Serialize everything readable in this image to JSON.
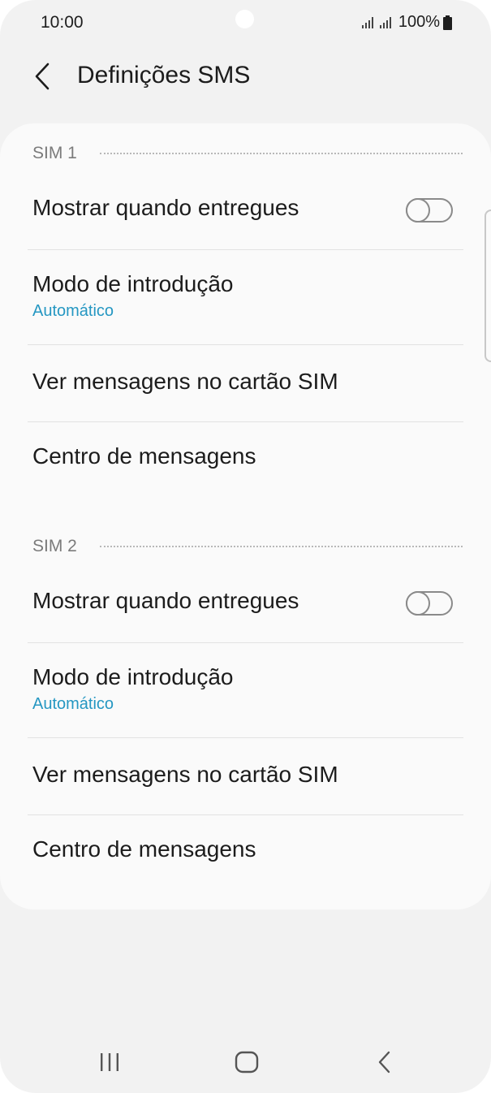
{
  "status_bar": {
    "time": "10:00",
    "battery": "100%"
  },
  "header": {
    "title": "Definições SMS",
    "back_icon": "chevron-left-icon"
  },
  "sections": [
    {
      "title": "SIM 1",
      "items": [
        {
          "label": "Mostrar quando entregues",
          "toggle": false
        },
        {
          "label": "Modo de introdução",
          "value": "Automático"
        },
        {
          "label": "Ver mensagens no cartão SIM"
        },
        {
          "label": "Centro de mensagens"
        }
      ]
    },
    {
      "title": "SIM 2",
      "items": [
        {
          "label": "Mostrar quando entregues",
          "toggle": false
        },
        {
          "label": "Modo de introdução",
          "value": "Automático"
        },
        {
          "label": "Ver mensagens no cartão SIM"
        },
        {
          "label": "Centro de mensagens"
        }
      ]
    }
  ],
  "navbar": {
    "recents_icon": "recents-icon",
    "home_icon": "home-icon",
    "back_icon": "back-icon"
  },
  "colors": {
    "background": "#f2f2f2",
    "card": "#fafafa",
    "accent": "#2597c2",
    "text": "#1c1c1c",
    "section_title": "#7b7b7b"
  }
}
